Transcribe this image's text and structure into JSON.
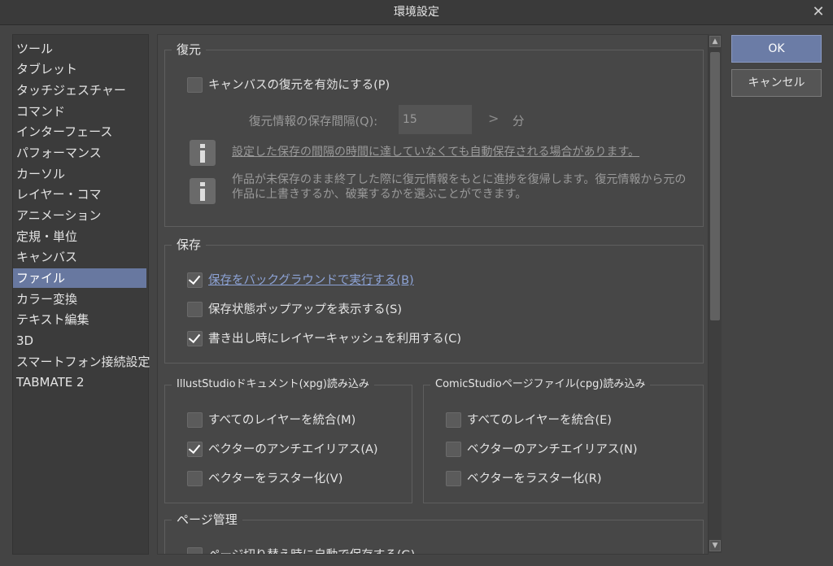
{
  "window": {
    "title": "環境設定"
  },
  "sidebar": {
    "items": [
      {
        "label": "ツール"
      },
      {
        "label": "タブレット"
      },
      {
        "label": "タッチジェスチャー"
      },
      {
        "label": "コマンド"
      },
      {
        "label": "インターフェース"
      },
      {
        "label": "パフォーマンス"
      },
      {
        "label": "カーソル"
      },
      {
        "label": "レイヤー・コマ"
      },
      {
        "label": "アニメーション"
      },
      {
        "label": "定規・単位"
      },
      {
        "label": "キャンバス"
      },
      {
        "label": "ファイル",
        "selected": true
      },
      {
        "label": "カラー変換"
      },
      {
        "label": "テキスト編集"
      },
      {
        "label": "3D"
      },
      {
        "label": "スマートフォン接続設定"
      },
      {
        "label": "TABMATE 2"
      }
    ]
  },
  "restore": {
    "title": "復元",
    "enable_label": "キャンバスの復元を有効にする(P)",
    "enable_checked": false,
    "interval_label": "復元情報の保存間隔(Q):",
    "interval_value": "15",
    "interval_arrow": ">",
    "interval_unit": "分",
    "info1": "設定した保存の間隔の時間に達していなくても自動保存される場合があります。",
    "info2": "作品が未保存のまま終了した際に復元情報をもとに進捗を復帰します。復元情報から元の作品に上書きするか、破棄するかを選ぶことができます。"
  },
  "save": {
    "title": "保存",
    "background_label": "保存をバックグラウンドで実行する(B)",
    "background_checked": true,
    "popup_label": "保存状態ポップアップを表示する(S)",
    "popup_checked": false,
    "cache_label": "書き出し時にレイヤーキャッシュを利用する(C)",
    "cache_checked": true
  },
  "xpg": {
    "title": "IllustStudioドキュメント(xpg)読み込み",
    "merge_label": "すべてのレイヤーを統合(M)",
    "merge_checked": false,
    "antialias_label": "ベクターのアンチエイリアス(A)",
    "antialias_checked": true,
    "rasterize_label": "ベクターをラスター化(V)",
    "rasterize_checked": false
  },
  "cpg": {
    "title": "ComicStudioページファイル(cpg)読み込み",
    "merge_label": "すべてのレイヤーを統合(E)",
    "merge_checked": false,
    "antialias_label": "ベクターのアンチエイリアス(N)",
    "antialias_checked": false,
    "rasterize_label": "ベクターをラスター化(R)",
    "rasterize_checked": false
  },
  "page": {
    "title": "ページ管理",
    "partial_label": "ページ切り替え時に自動で保存する(G)"
  },
  "buttons": {
    "ok": "OK",
    "cancel": "キャンセル"
  },
  "colors": {
    "accent": "#6b7ca6",
    "selected": "#6878a0",
    "link": "#8da3d6"
  }
}
